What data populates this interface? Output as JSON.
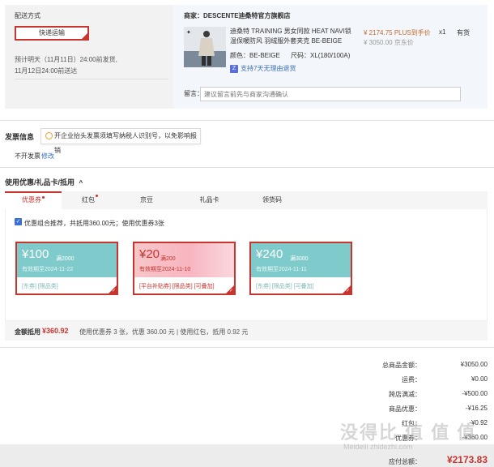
{
  "shipping": {
    "title": "配送方式",
    "method": "快递运输",
    "estimate_line1": "预计明天（11月11日）24:00前发货,",
    "estimate_line2": "11月12日24:00前送达"
  },
  "product": {
    "shop": "商家：DESCENTE迪桑特官方旗舰店",
    "name": "迪桑特 TRAINING 男女同款 HEAT NAVI锁温保暖防风 羽绒服外套夹克 BE-BEIGE",
    "color": "颜色：BE-BEIGE",
    "size": "尺码：XL(180/100A)",
    "return_icon": "Z",
    "return_policy": "支持7天无理由退货",
    "price": "¥ 2174.75 PLUS到手价",
    "orig_price": "¥ 3050.00 京东价",
    "qty": "x1",
    "stock": "有货",
    "message_label": "留言：",
    "message_placeholder": "建议留言前先与商家沟通确认"
  },
  "invoice": {
    "title": "发票信息",
    "tip": "开企业抬头发票须填写纳税人识别号，以免影响报销",
    "value": "不开发票",
    "modify": "修改"
  },
  "coupons": {
    "title": "使用优惠/礼品卡/抵用",
    "chevron": "^",
    "tabs": [
      {
        "label": "优惠券",
        "dot": true
      },
      {
        "label": "红包",
        "dot": true
      },
      {
        "label": "京豆",
        "dot": false
      },
      {
        "label": "礼品卡",
        "dot": false
      },
      {
        "label": "领货码",
        "dot": false
      }
    ],
    "checkbox_mark": "✓",
    "combo_text": "优惠组合推荐，共抵用360.00元；使用优惠券3张",
    "cards": [
      {
        "amount": "¥100",
        "cond": "满2000",
        "valid": "有效期至2024-11-22",
        "tags": "[东券] [限品类]"
      },
      {
        "amount": "¥20",
        "cond": "满200",
        "valid": "有效期至2024-11-10",
        "tags": "[平台补贴券] [限品类] [可叠加]"
      },
      {
        "amount": "¥240",
        "cond": "满3000",
        "valid": "有效期至2024-11-11",
        "tags": "[东券] [限品类] [可叠加]"
      }
    ],
    "summary_label": "金额抵用",
    "summary_amount": "¥360.92",
    "summary_note": "使用优惠券 3 张，优惠 360.00 元 | 使用红包，抵用 0.92 元"
  },
  "totals": {
    "rows": [
      {
        "label": "总商品金额：",
        "value": "¥3050.00"
      },
      {
        "label": "运费：",
        "value": "¥0.00"
      },
      {
        "label": "跨店满减：",
        "value": "-¥500.00"
      },
      {
        "label": "商品优惠：",
        "value": "-¥16.25"
      },
      {
        "label": "红包：",
        "value": "-¥0.92"
      },
      {
        "label": "优惠券：",
        "value": "-¥360.00"
      }
    ],
    "pay_label": "应付总额：",
    "pay_amount": "¥2173.83"
  },
  "watermark": {
    "text": "没得比 值 值 值",
    "url": "Meideiii zhidezhi.com"
  },
  "colors": {
    "accent": "#c8342e",
    "coupon_teal": "#7fcbcc",
    "link": "#3b6fb6"
  }
}
